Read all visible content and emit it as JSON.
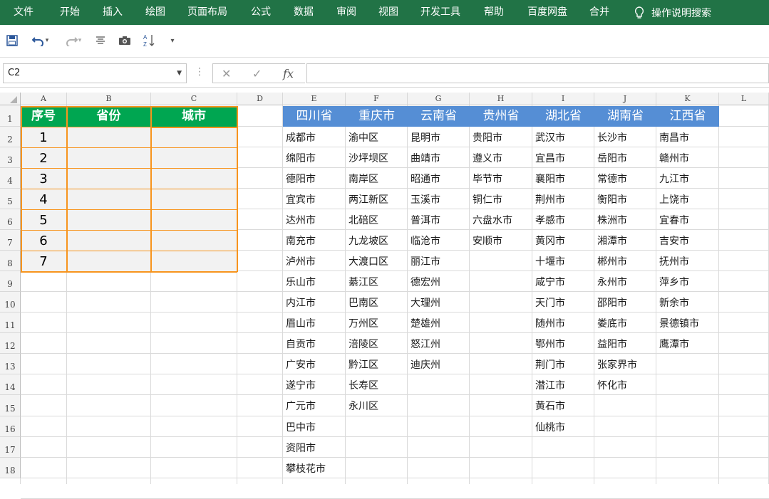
{
  "ribbon": {
    "tabs": [
      "文件",
      "开始",
      "插入",
      "绘图",
      "页面布局",
      "公式",
      "数据",
      "审阅",
      "视图",
      "开发工具",
      "帮助",
      "百度网盘",
      "合并"
    ],
    "tell_me": "操作说明搜索"
  },
  "namebox": {
    "value": "C2"
  },
  "formula": {
    "value": ""
  },
  "columns": [
    "A",
    "B",
    "C",
    "D",
    "E",
    "F",
    "G",
    "H",
    "I",
    "J",
    "K",
    "L"
  ],
  "rows": [
    "1",
    "2",
    "3",
    "4",
    "5",
    "6",
    "7",
    "8",
    "9",
    "10",
    "11",
    "12",
    "13",
    "14",
    "15",
    "16",
    "17",
    "18"
  ],
  "left_table": {
    "headers": [
      "序号",
      "省份",
      "城市"
    ],
    "numbers": [
      "1",
      "2",
      "3",
      "4",
      "5",
      "6",
      "7"
    ]
  },
  "province_table": {
    "headers": [
      "四川省",
      "重庆市",
      "云南省",
      "贵州省",
      "湖北省",
      "湖南省",
      "江西省"
    ],
    "columns": [
      [
        "成都市",
        "绵阳市",
        "德阳市",
        "宜宾市",
        "达州市",
        "南充市",
        "泸州市",
        "乐山市",
        "内江市",
        "眉山市",
        "自贡市",
        "广安市",
        "遂宁市",
        "广元市",
        "巴中市",
        "资阳市",
        "攀枝花市"
      ],
      [
        "渝中区",
        "沙坪坝区",
        "南岸区",
        "两江新区",
        "北碚区",
        "九龙坡区",
        "大渡口区",
        "綦江区",
        "巴南区",
        "万州区",
        "涪陵区",
        "黔江区",
        "长寿区",
        "永川区"
      ],
      [
        "昆明市",
        "曲靖市",
        "昭通市",
        "玉溪市",
        "普洱市",
        "临沧市",
        "丽江市",
        "德宏州",
        "大理州",
        "楚雄州",
        "怒江州",
        "迪庆州"
      ],
      [
        "贵阳市",
        "遵义市",
        "毕节市",
        "铜仁市",
        "六盘水市",
        "安顺市"
      ],
      [
        "武汉市",
        "宜昌市",
        "襄阳市",
        "荆州市",
        "孝感市",
        "黄冈市",
        "十堰市",
        "咸宁市",
        "天门市",
        "随州市",
        "鄂州市",
        "荆门市",
        "潜江市",
        "黄石市",
        "仙桃市"
      ],
      [
        "长沙市",
        "岳阳市",
        "常德市",
        "衡阳市",
        "株洲市",
        "湘潭市",
        "郴州市",
        "永州市",
        "邵阳市",
        "娄底市",
        "益阳市",
        "张家界市",
        "怀化市"
      ],
      [
        "南昌市",
        "赣州市",
        "九江市",
        "上饶市",
        "宜春市",
        "吉安市",
        "抚州市",
        "萍乡市",
        "新余市",
        "景德镇市",
        "鹰潭市"
      ]
    ]
  },
  "colors": {
    "ribbon": "#217346",
    "green_header": "#00a651",
    "blue_header": "#558ed5",
    "orange_border": "#f7941d"
  }
}
